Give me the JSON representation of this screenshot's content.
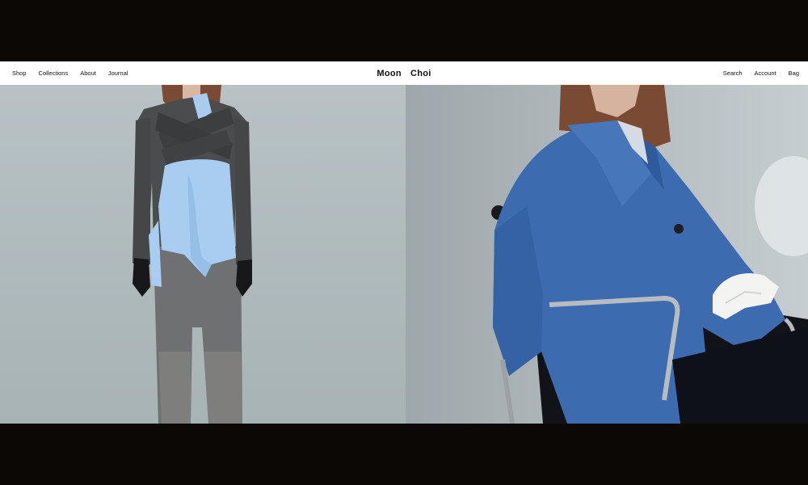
{
  "brand": {
    "first": "Moon",
    "second": "Choi"
  },
  "nav_left": [
    "Shop",
    "Collections",
    "About",
    "Journal"
  ],
  "nav_right": [
    "Search",
    "Account",
    "Bag"
  ],
  "hero": {
    "left_image": "model-grey-suit-crossed-blue-shirt",
    "right_image": "model-blue-blazer-seated-white-glove"
  },
  "colors": {
    "header_bg": "#ffffff",
    "letterbox": "#0b0806",
    "text": "#111111"
  }
}
